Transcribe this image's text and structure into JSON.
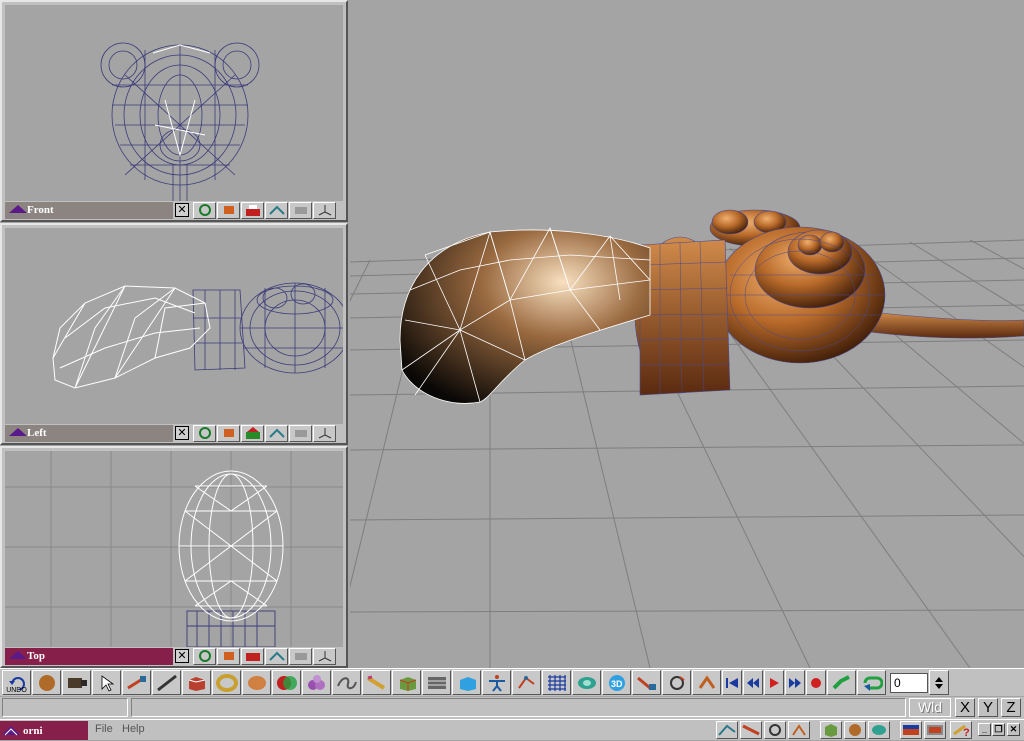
{
  "viewports": {
    "front": {
      "label": "Front",
      "close": "✕"
    },
    "left": {
      "label": "Left",
      "close": "✕"
    },
    "top": {
      "label": "Top",
      "close": "✕"
    }
  },
  "toolbar": {
    "undo_label": "UNDO",
    "frame_value": "0"
  },
  "status": {
    "coord_space": "Wld",
    "axis_x": "X",
    "axis_y": "Y",
    "axis_z": "Z"
  },
  "taskbar": {
    "app_name": "orni",
    "menu_file": "File",
    "menu_help": "Help",
    "win_min": "_",
    "win_restore": "❐",
    "win_close": "✕"
  },
  "colors": {
    "active_title": "#86204a",
    "inactive_title": "#8c8480",
    "wire_selected": "#ffffff",
    "wire_unselected": "#3a3a7a",
    "render_copper": "#c0783a",
    "viewport_bg": "#a4a4a4"
  },
  "icons": [
    "undo-icon",
    "sphere-icon",
    "camera-icon",
    "select-arrow-icon",
    "move-icon",
    "line-tool-icon",
    "box-primitive-icon",
    "torus-icon",
    "egg-icon",
    "boolean-icon",
    "blob-icon",
    "curve-icon",
    "pencil-icon",
    "cube-icon",
    "grid-panel-icon",
    "cyan-box-icon",
    "figure-icon",
    "bone-icon",
    "grid-icon",
    "render-icon",
    "3d-icon",
    "scale-icon",
    "rotate-icon",
    "transform-icon",
    "rewind-icon",
    "step-back-icon",
    "play-icon",
    "step-forward-icon",
    "record-icon",
    "key-icon",
    "loop-icon",
    "spinner-icon"
  ]
}
